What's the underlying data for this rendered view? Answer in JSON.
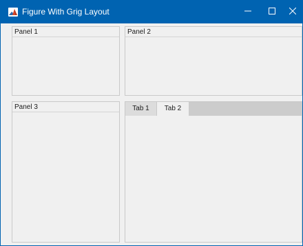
{
  "window": {
    "title": "Figure With Grig Layout",
    "accent_color": "#0063b1",
    "app_icon": "matlab-logo-icon",
    "controls": {
      "minimize": "minimize-icon",
      "maximize": "maximize-icon",
      "close": "close-icon"
    }
  },
  "panels": [
    {
      "title": "Panel 1"
    },
    {
      "title": "Panel 2"
    },
    {
      "title": "Panel 3"
    }
  ],
  "tab_group": {
    "tabs": [
      {
        "label": "Tab 1",
        "selected": false
      },
      {
        "label": "Tab 2",
        "selected": true
      }
    ]
  }
}
